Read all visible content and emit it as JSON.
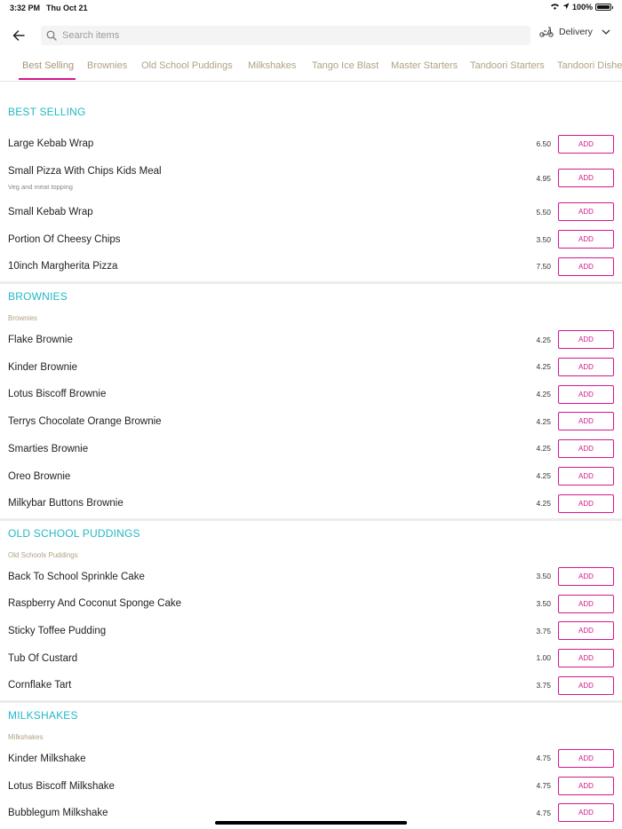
{
  "status_bar": {
    "time": "3:32 PM",
    "date": "Thu Oct 21",
    "battery": "100%"
  },
  "search": {
    "placeholder": "Search items",
    "value": ""
  },
  "delivery": {
    "label": "Delivery"
  },
  "tabs": [
    {
      "label": "Best Selling",
      "active": true
    },
    {
      "label": "Brownies"
    },
    {
      "label": "Old School Puddings"
    },
    {
      "label": "Milkshakes"
    },
    {
      "label": "Tango Ice Blast"
    },
    {
      "label": "Master Starters"
    },
    {
      "label": "Tandoori Starters"
    },
    {
      "label": "Tandoori Dishes"
    }
  ],
  "add_label": "ADD",
  "sections": [
    {
      "title": "BEST SELLING",
      "subtitle": "",
      "items": [
        {
          "name": "Large Kebab Wrap",
          "price": "6.50"
        },
        {
          "name": "Small Pizza With Chips Kids Meal",
          "description": "Veg and meat topping",
          "price": "4.95"
        },
        {
          "name": "Small Kebab Wrap",
          "price": "5.50"
        },
        {
          "name": "Portion Of Cheesy Chips",
          "price": "3.50"
        },
        {
          "name": "10inch Margherita Pizza",
          "price": "7.50"
        }
      ]
    },
    {
      "title": "BROWNIES",
      "subtitle": "Brownies",
      "items": [
        {
          "name": "Flake Brownie",
          "price": "4.25"
        },
        {
          "name": "Kinder Brownie",
          "price": "4.25"
        },
        {
          "name": "Lotus Biscoff Brownie",
          "price": "4.25"
        },
        {
          "name": "Terrys Chocolate Orange Brownie",
          "price": "4.25"
        },
        {
          "name": "Smarties Brownie",
          "price": "4.25"
        },
        {
          "name": "Oreo Brownie",
          "price": "4.25"
        },
        {
          "name": "Milkybar Buttons Brownie",
          "price": "4.25"
        }
      ]
    },
    {
      "title": "OLD SCHOOL PUDDINGS",
      "subtitle": "Old Schools Puddings",
      "items": [
        {
          "name": "Back To School Sprinkle Cake",
          "price": "3.50"
        },
        {
          "name": "Raspberry And Coconut Sponge Cake",
          "price": "3.50"
        },
        {
          "name": "Sticky Toffee Pudding",
          "price": "3.75"
        },
        {
          "name": "Tub Of Custard",
          "price": "1.00"
        },
        {
          "name": "Cornflake Tart",
          "price": "3.75"
        }
      ]
    },
    {
      "title": "MILKSHAKES",
      "subtitle": "Milkshakes",
      "items": [
        {
          "name": "Kinder Milkshake",
          "price": "4.75"
        },
        {
          "name": "Lotus Biscoff Milkshake",
          "price": "4.75"
        },
        {
          "name": "Bubblegum Milkshake",
          "price": "4.75"
        }
      ]
    }
  ],
  "colors": {
    "accent": "#d6168f",
    "section_title": "#22b8c6",
    "subtitle": "#b0a285"
  }
}
